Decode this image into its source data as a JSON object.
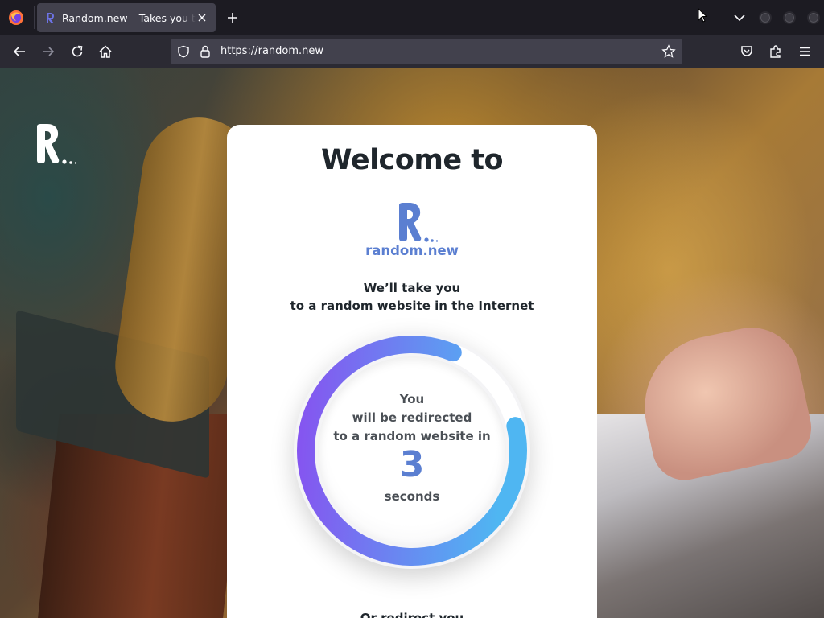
{
  "browser": {
    "tab_title": "Random.new – Takes you to a random website",
    "url": "https://random.new",
    "icons": [
      "firefox-logo-icon",
      "close-icon",
      "plus-icon",
      "chevron-down-icon",
      "back-arrow-icon",
      "forward-arrow-icon",
      "reload-icon",
      "home-icon",
      "shield-icon",
      "lock-icon",
      "star-icon",
      "pocket-icon",
      "extensions-icon",
      "hamburger-menu-icon"
    ]
  },
  "page": {
    "welcome": "Welcome to",
    "brand_name": "random.new",
    "tagline_line1": "We’ll take you",
    "tagline_line2": "to a random website in the Internet",
    "countdown": {
      "line1": "You",
      "line2": "will be redirected",
      "line3": "to a random website in",
      "seconds_value": "3",
      "unit": "seconds",
      "progress_fraction": 0.85
    },
    "or_text": "Or redirect you"
  },
  "colors": {
    "accent": "#5b7fd1",
    "ring_start": "#8a4cf0",
    "ring_end": "#4fb6f2"
  }
}
